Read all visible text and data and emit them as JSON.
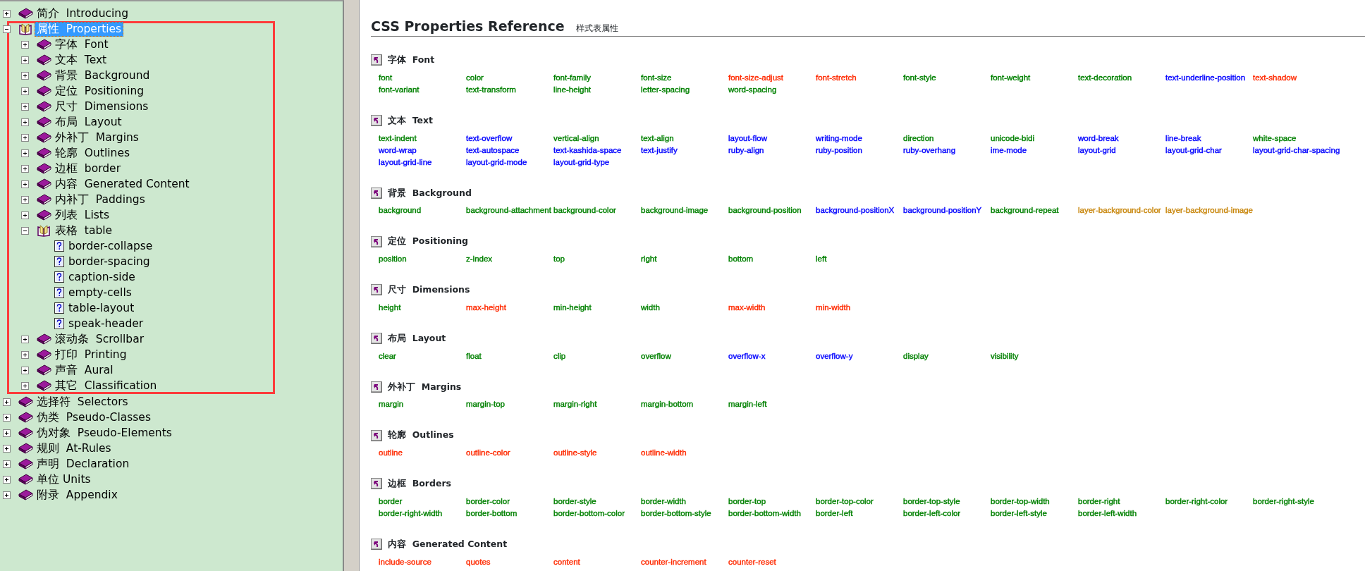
{
  "tree": [
    {
      "label": "简介  Introducing",
      "kind": "book",
      "expanded": false,
      "selected": false
    },
    {
      "label": "属性  Properties",
      "kind": "book",
      "expanded": true,
      "selected": true,
      "framed": true,
      "children": [
        {
          "label": "字体  Font",
          "kind": "book",
          "expanded": false,
          "selected": false
        },
        {
          "label": "文本  Text",
          "kind": "book",
          "expanded": false,
          "selected": false
        },
        {
          "label": "背景  Background",
          "kind": "book",
          "expanded": false,
          "selected": false
        },
        {
          "label": "定位  Positioning",
          "kind": "book",
          "expanded": false,
          "selected": false
        },
        {
          "label": "尺寸  Dimensions",
          "kind": "book",
          "expanded": false,
          "selected": false
        },
        {
          "label": "布局  Layout",
          "kind": "book",
          "expanded": false,
          "selected": false
        },
        {
          "label": "外补丁  Margins",
          "kind": "book",
          "expanded": false,
          "selected": false
        },
        {
          "label": "轮廓  Outlines",
          "kind": "book",
          "expanded": false,
          "selected": false
        },
        {
          "label": "边框  border",
          "kind": "book",
          "expanded": false,
          "selected": false
        },
        {
          "label": "内容  Generated Content",
          "kind": "book",
          "expanded": false,
          "selected": false
        },
        {
          "label": "内补丁  Paddings",
          "kind": "book",
          "expanded": false,
          "selected": false
        },
        {
          "label": "列表  Lists",
          "kind": "book",
          "expanded": false,
          "selected": false
        },
        {
          "label": "表格  table",
          "kind": "book",
          "expanded": true,
          "selected": false,
          "children": [
            {
              "label": "border-collapse",
              "kind": "page",
              "selected": false
            },
            {
              "label": "border-spacing",
              "kind": "page",
              "selected": false
            },
            {
              "label": "caption-side",
              "kind": "page",
              "selected": false
            },
            {
              "label": "empty-cells",
              "kind": "page",
              "selected": false
            },
            {
              "label": "table-layout",
              "kind": "page",
              "selected": false
            },
            {
              "label": "speak-header",
              "kind": "page",
              "selected": false
            }
          ]
        },
        {
          "label": "滚动条  Scrollbar",
          "kind": "book",
          "expanded": false,
          "selected": false
        },
        {
          "label": "打印  Printing",
          "kind": "book",
          "expanded": false,
          "selected": false
        },
        {
          "label": "声音  Aural",
          "kind": "book",
          "expanded": false,
          "selected": false
        },
        {
          "label": "其它  Classification",
          "kind": "book",
          "expanded": false,
          "selected": false
        }
      ]
    },
    {
      "label": "选择符  Selectors",
      "kind": "book",
      "expanded": false,
      "selected": false
    },
    {
      "label": "伪类  Pseudo-Classes",
      "kind": "book",
      "expanded": false,
      "selected": false
    },
    {
      "label": "伪对象  Pseudo-Elements",
      "kind": "book",
      "expanded": false,
      "selected": false
    },
    {
      "label": "规则  At-Rules",
      "kind": "book",
      "expanded": false,
      "selected": false
    },
    {
      "label": "声明  Declaration",
      "kind": "book",
      "expanded": false,
      "selected": false
    },
    {
      "label": "单位 Units",
      "kind": "book",
      "expanded": false,
      "selected": false
    },
    {
      "label": "附录  Appendix",
      "kind": "book",
      "expanded": false,
      "selected": false
    }
  ],
  "page": {
    "title": "CSS Properties Reference",
    "subtitle": "样式表属性",
    "sections": [
      {
        "heading": "字体  Font",
        "items": [
          {
            "text": "font",
            "color": "#008000"
          },
          {
            "text": "color",
            "color": "#008000"
          },
          {
            "text": "font-family",
            "color": "#008000"
          },
          {
            "text": "font-size",
            "color": "#008000"
          },
          {
            "text": "font-size-adjust",
            "color": "#ff2a00"
          },
          {
            "text": "font-stretch",
            "color": "#ff2a00"
          },
          {
            "text": "font-style",
            "color": "#008000"
          },
          {
            "text": "font-weight",
            "color": "#008000"
          },
          {
            "text": "text-decoration",
            "color": "#008000"
          },
          {
            "text": "text-underline-position",
            "color": "#0000ff"
          },
          {
            "text": "text-shadow",
            "color": "#ff2a00"
          },
          {
            "text": "font-variant",
            "color": "#008000"
          },
          {
            "text": "text-transform",
            "color": "#008000"
          },
          {
            "text": "line-height",
            "color": "#008000"
          },
          {
            "text": "letter-spacing",
            "color": "#008000"
          },
          {
            "text": "word-spacing",
            "color": "#008000"
          }
        ]
      },
      {
        "heading": "文本  Text",
        "items": [
          {
            "text": "text-indent",
            "color": "#008000"
          },
          {
            "text": "text-overflow",
            "color": "#0000ff"
          },
          {
            "text": "vertical-align",
            "color": "#008000"
          },
          {
            "text": "text-align",
            "color": "#008000"
          },
          {
            "text": "layout-flow",
            "color": "#0000ff"
          },
          {
            "text": "writing-mode",
            "color": "#0000ff"
          },
          {
            "text": "direction",
            "color": "#008000"
          },
          {
            "text": "unicode-bidi",
            "color": "#008000"
          },
          {
            "text": "word-break",
            "color": "#0000ff"
          },
          {
            "text": "line-break",
            "color": "#0000ff"
          },
          {
            "text": "white-space",
            "color": "#008000"
          },
          {
            "text": "word-wrap",
            "color": "#0000ff"
          },
          {
            "text": "text-autospace",
            "color": "#0000ff"
          },
          {
            "text": "text-kashida-space",
            "color": "#0000ff"
          },
          {
            "text": "text-justify",
            "color": "#0000ff"
          },
          {
            "text": "ruby-align",
            "color": "#0000ff"
          },
          {
            "text": "ruby-position",
            "color": "#0000ff"
          },
          {
            "text": "ruby-overhang",
            "color": "#0000ff"
          },
          {
            "text": "ime-mode",
            "color": "#0000ff"
          },
          {
            "text": "layout-grid",
            "color": "#0000ff"
          },
          {
            "text": "layout-grid-char",
            "color": "#0000ff"
          },
          {
            "text": "layout-grid-char-spacing",
            "color": "#0000ff"
          },
          {
            "text": "layout-grid-line",
            "color": "#0000ff"
          },
          {
            "text": "layout-grid-mode",
            "color": "#0000ff"
          },
          {
            "text": "layout-grid-type",
            "color": "#0000ff"
          }
        ]
      },
      {
        "heading": "背景  Background",
        "items": [
          {
            "text": "background",
            "color": "#008000"
          },
          {
            "text": "background-attachment",
            "color": "#008000"
          },
          {
            "text": "background-color",
            "color": "#008000"
          },
          {
            "text": "background-image",
            "color": "#008000"
          },
          {
            "text": "background-position",
            "color": "#008000"
          },
          {
            "text": "background-positionX",
            "color": "#0000ff"
          },
          {
            "text": "background-positionY",
            "color": "#0000ff"
          },
          {
            "text": "background-repeat",
            "color": "#008000"
          },
          {
            "text": "layer-background-color",
            "color": "#c8860b"
          },
          {
            "text": "layer-background-image",
            "color": "#c8860b"
          }
        ]
      },
      {
        "heading": "定位  Positioning",
        "items": [
          {
            "text": "position",
            "color": "#008000"
          },
          {
            "text": "z-index",
            "color": "#008000"
          },
          {
            "text": "top",
            "color": "#008000"
          },
          {
            "text": "right",
            "color": "#008000"
          },
          {
            "text": "bottom",
            "color": "#008000"
          },
          {
            "text": "left",
            "color": "#008000"
          }
        ]
      },
      {
        "heading": "尺寸  Dimensions",
        "items": [
          {
            "text": "height",
            "color": "#008000"
          },
          {
            "text": "max-height",
            "color": "#ff2a00"
          },
          {
            "text": "min-height",
            "color": "#008000"
          },
          {
            "text": "width",
            "color": "#008000"
          },
          {
            "text": "max-width",
            "color": "#ff2a00"
          },
          {
            "text": "min-width",
            "color": "#ff2a00"
          }
        ]
      },
      {
        "heading": "布局  Layout",
        "items": [
          {
            "text": "clear",
            "color": "#008000"
          },
          {
            "text": "float",
            "color": "#008000"
          },
          {
            "text": "clip",
            "color": "#008000"
          },
          {
            "text": "overflow",
            "color": "#008000"
          },
          {
            "text": "overflow-x",
            "color": "#0000ff"
          },
          {
            "text": "overflow-y",
            "color": "#0000ff"
          },
          {
            "text": "display",
            "color": "#008000"
          },
          {
            "text": "visibility",
            "color": "#008000"
          }
        ]
      },
      {
        "heading": "外补丁  Margins",
        "items": [
          {
            "text": "margin",
            "color": "#008000"
          },
          {
            "text": "margin-top",
            "color": "#008000"
          },
          {
            "text": "margin-right",
            "color": "#008000"
          },
          {
            "text": "margin-bottom",
            "color": "#008000"
          },
          {
            "text": "margin-left",
            "color": "#008000"
          }
        ]
      },
      {
        "heading": "轮廓  Outlines",
        "items": [
          {
            "text": "outline",
            "color": "#ff2a00"
          },
          {
            "text": "outline-color",
            "color": "#ff2a00"
          },
          {
            "text": "outline-style",
            "color": "#ff2a00"
          },
          {
            "text": "outline-width",
            "color": "#ff2a00"
          }
        ]
      },
      {
        "heading": "边框  Borders",
        "items": [
          {
            "text": "border",
            "color": "#008000"
          },
          {
            "text": "border-color",
            "color": "#008000"
          },
          {
            "text": "border-style",
            "color": "#008000"
          },
          {
            "text": "border-width",
            "color": "#008000"
          },
          {
            "text": "border-top",
            "color": "#008000"
          },
          {
            "text": "border-top-color",
            "color": "#008000"
          },
          {
            "text": "border-top-style",
            "color": "#008000"
          },
          {
            "text": "border-top-width",
            "color": "#008000"
          },
          {
            "text": "border-right",
            "color": "#008000"
          },
          {
            "text": "border-right-color",
            "color": "#008000"
          },
          {
            "text": "border-right-style",
            "color": "#008000"
          },
          {
            "text": "border-right-width",
            "color": "#008000"
          },
          {
            "text": "border-bottom",
            "color": "#008000"
          },
          {
            "text": "border-bottom-color",
            "color": "#008000"
          },
          {
            "text": "border-bottom-style",
            "color": "#008000"
          },
          {
            "text": "border-bottom-width",
            "color": "#008000"
          },
          {
            "text": "border-left",
            "color": "#008000"
          },
          {
            "text": "border-left-color",
            "color": "#008000"
          },
          {
            "text": "border-left-style",
            "color": "#008000"
          },
          {
            "text": "border-left-width",
            "color": "#008000"
          }
        ]
      },
      {
        "heading": "内容  Generated Content",
        "items": [
          {
            "text": "include-source",
            "color": "#ff2a00"
          },
          {
            "text": "quotes",
            "color": "#ff2a00"
          },
          {
            "text": "content",
            "color": "#ff2a00"
          },
          {
            "text": "counter-increment",
            "color": "#ff2a00"
          },
          {
            "text": "counter-reset",
            "color": "#ff2a00"
          }
        ]
      }
    ]
  }
}
